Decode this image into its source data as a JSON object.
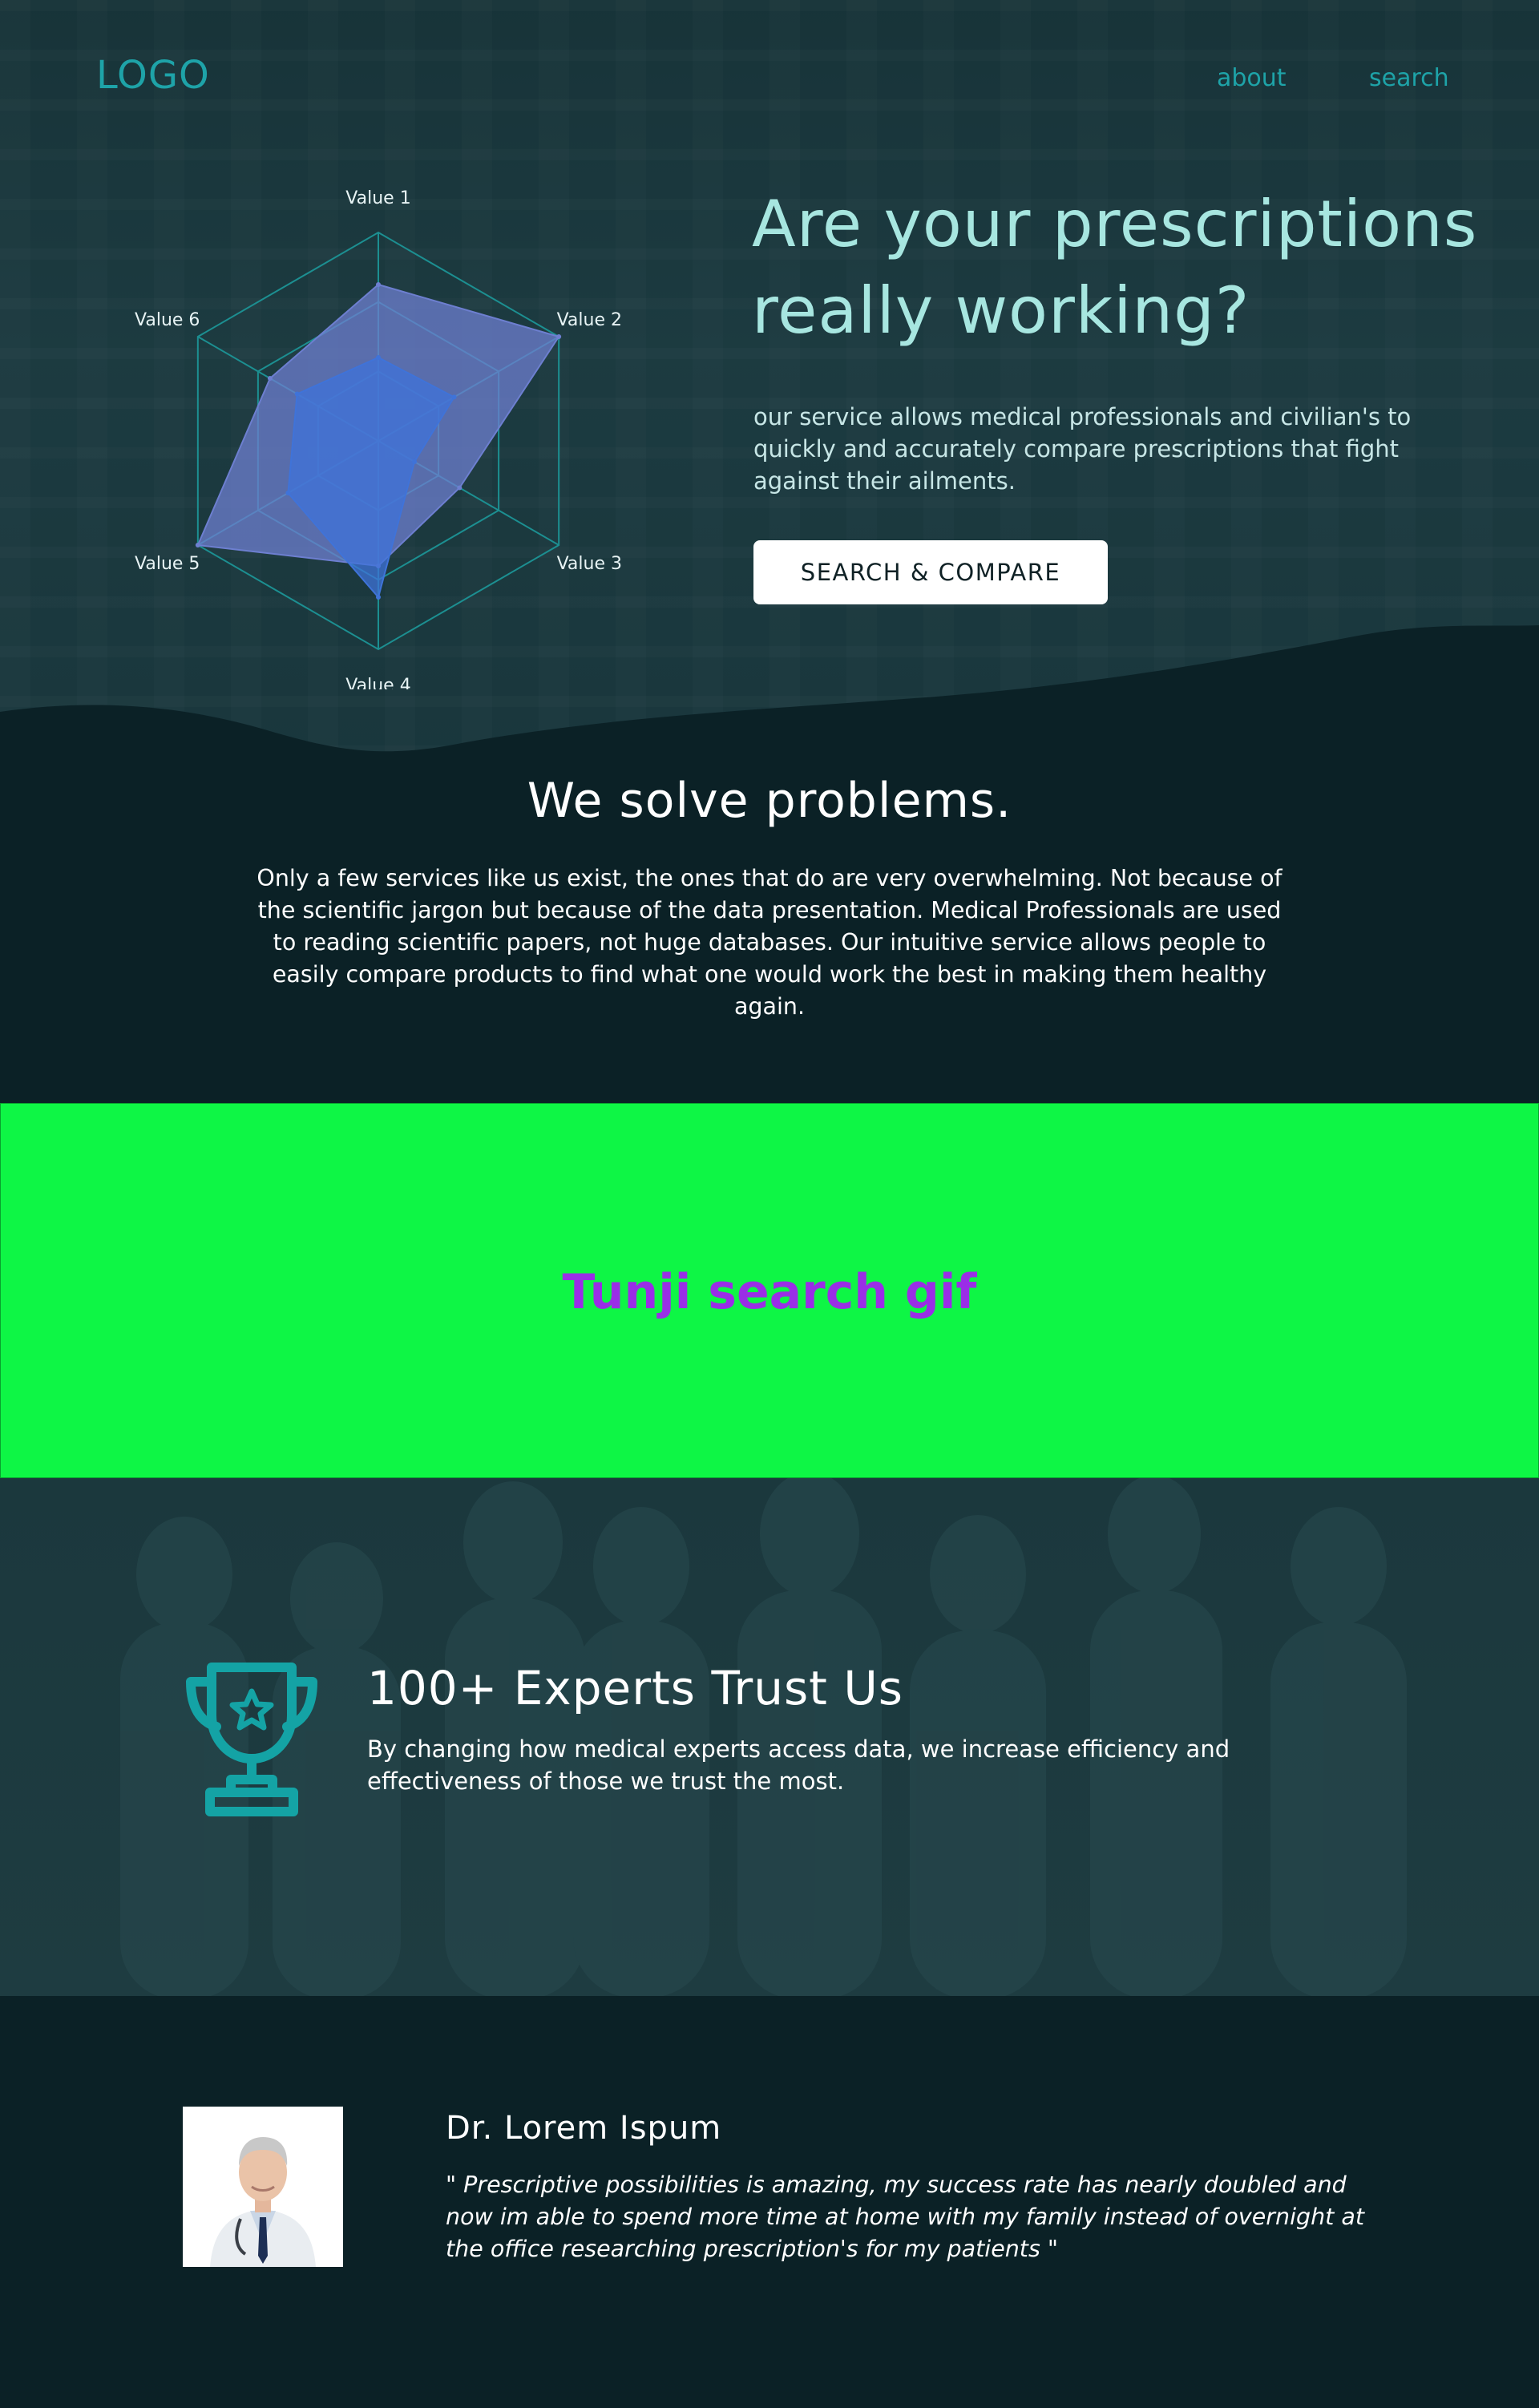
{
  "nav": {
    "logo": "LOGO",
    "about": "about",
    "search": "search"
  },
  "hero": {
    "headline": "Are your prescriptions really working?",
    "subtext": "our service allows medical professionals and civilian's to quickly and accurately compare prescriptions that fight against their ailments.",
    "cta_label": "SEARCH & COMPARE"
  },
  "chart_data": {
    "type": "radar",
    "axes": [
      "Value 1",
      "Value 2",
      "Value 3",
      "Value 4",
      "Value 5",
      "Value 6"
    ],
    "range": [
      0,
      100
    ],
    "rings": 3,
    "series": [
      {
        "values": [
          75,
          100,
          45,
          60,
          100,
          60
        ],
        "color": "#6d7fd0"
      },
      {
        "values": [
          40,
          42,
          20,
          75,
          50,
          45
        ],
        "color": "#3f73d9"
      }
    ],
    "grid_color": "#1c8f91"
  },
  "problems": {
    "title": "We solve problems.",
    "body": "Only a few services like us exist, the ones that do are very overwhelming. Not because of the scientific jargon but because of the data presentation. Medical Professionals are used to reading scientific papers, not huge databases. Our intuitive service allows people to easily compare products to find what one would work the best in making them healthy again."
  },
  "gif_placeholder": {
    "text": "Tunji search gif"
  },
  "experts": {
    "icon": "trophy-icon",
    "title": "100+ Experts Trust Us",
    "body": "By changing how medical experts access data, we increase efficiency and effectiveness of those we trust the most."
  },
  "testimonial": {
    "name": "Dr. Lorem Ispum",
    "quote": "\" Prescriptive possibilities is amazing, my success rate has nearly doubled and now im able to spend more time at home with my family instead of overnight at the office researching prescription's for my patients \""
  },
  "colors": {
    "accent": "#1ea3a8",
    "headline": "#a7e6e0",
    "background": "#0b2126",
    "gif_bg": "#0ef645",
    "gif_text": "#9a2ee6"
  }
}
